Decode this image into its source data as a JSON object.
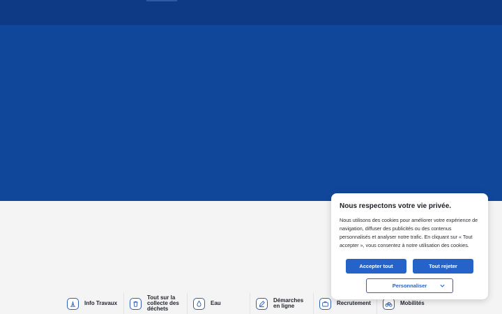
{
  "cookie_banner": {
    "title": "Nous respectons votre vie privée.",
    "body": "Nous utilisons des cookies pour améliorer votre expérience de navigation, diffuser des publicités ou des contenus personnalisés et analyser notre trafic. En cliquant sur « Tout accepter », vous consentez à notre utilisation des cookies.",
    "accept_label": "Accepter tout",
    "reject_label": "Tout rejeter",
    "customize_label": "Personnaliser"
  },
  "quick_links": [
    {
      "label": "Info Travaux",
      "icon": "construction-icon"
    },
    {
      "label": "Tout sur la collecte des déchets",
      "icon": "trash-icon"
    },
    {
      "label": "Eau",
      "icon": "water-drop-icon"
    },
    {
      "label": "Démarches en ligne",
      "icon": "pen-icon"
    },
    {
      "label": "Recrutement",
      "icon": "briefcase-icon"
    },
    {
      "label": "Mobilités",
      "icon": "bicycle-icon"
    }
  ],
  "colors": {
    "header": "#0e3a85",
    "hero": "#11479b",
    "accent": "#2563c9",
    "page_background": "#f4f4f5"
  }
}
